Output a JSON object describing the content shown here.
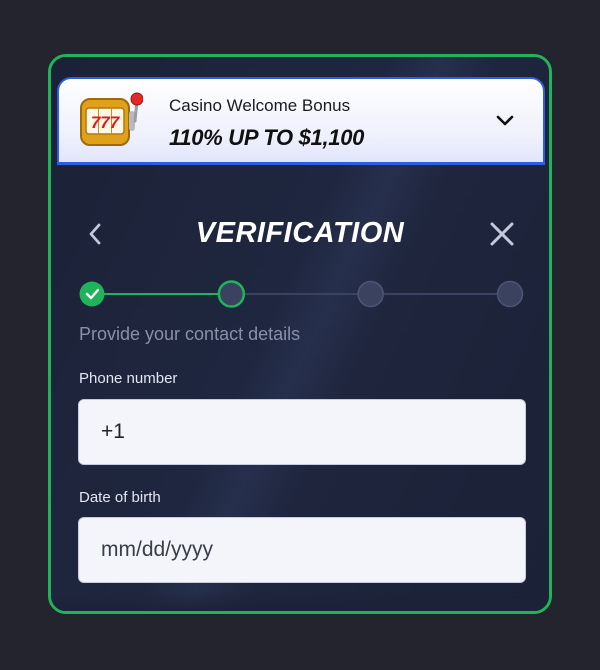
{
  "bonus": {
    "title": "Casino Welcome Bonus",
    "amount": "110% UP TO $1,100",
    "slot_label": "777",
    "icon": "slot-machine-icon",
    "toggle_icon": "chevron-down-icon"
  },
  "header": {
    "title": "VERIFICATION",
    "back_icon": "chevron-left-icon",
    "close_icon": "close-icon"
  },
  "progress": {
    "total_steps": 4,
    "completed_steps": 1,
    "current_step": 2
  },
  "form": {
    "subtitle": "Provide your contact details",
    "phone": {
      "label": "Phone number",
      "value": "+1"
    },
    "dob": {
      "label": "Date of birth",
      "placeholder": "mm/dd/yyyy"
    }
  },
  "colors": {
    "accent_green": "#1fb35a",
    "accent_blue": "#2e5ee0",
    "panel": "#1c2238",
    "page": "#24242e"
  }
}
